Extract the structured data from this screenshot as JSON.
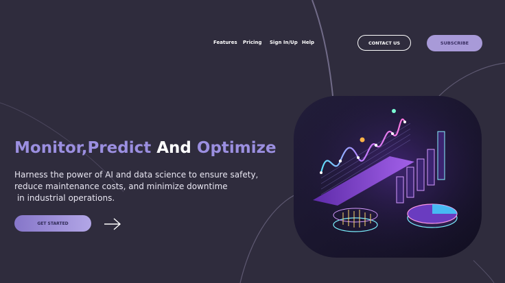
{
  "nav": {
    "links": [
      "Features",
      "Pricing",
      "Sign In/Up",
      "Help"
    ],
    "contact_label": "CONTACT US",
    "subscribe_label": "SUBSCRIBE"
  },
  "hero": {
    "headline_part1": "Monitor,Predict ",
    "headline_part2": "And ",
    "headline_part3": "Optimize",
    "subtext_lines": [
      "Harness the power of AI and data science to ensure safety,",
      "reduce maintenance costs, and minimize downtime",
      " in industrial operations."
    ],
    "cta_label": "GET STARTED"
  },
  "colors": {
    "background": "#2f2c3d",
    "accent": "#9b8fe0",
    "button_fill": "#a89ad8",
    "card": "#1c1830"
  },
  "icons": {
    "arrow": "arrow-right-icon",
    "illustration": "analytics-chart-illustration"
  }
}
